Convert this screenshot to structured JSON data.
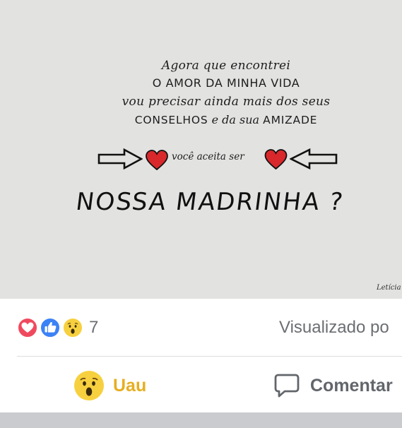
{
  "post": {
    "image_lines": [
      "Agora que encontrei",
      "O AMOR DA MINHA VIDA",
      "vou precisar ainda mais dos seus",
      "CONSELHOS",
      "e da sua",
      "AMIZADE"
    ],
    "invite_text": "você aceita ser",
    "title": "NOSSA MADRINHA ?",
    "signature": "Letícia"
  },
  "reactions": {
    "icons": [
      "heart-icon",
      "thumbs-up-icon",
      "wow-face-icon"
    ],
    "count": "7",
    "seen_label": "Visualizado po"
  },
  "actions": {
    "wow_label": "Uau",
    "comment_label": "Comentar"
  },
  "colors": {
    "love": "#f0495e",
    "like": "#3b82f6",
    "wow": "#f7d03f",
    "wow_text": "#e6ae21",
    "muted_text": "#6b6e72"
  }
}
